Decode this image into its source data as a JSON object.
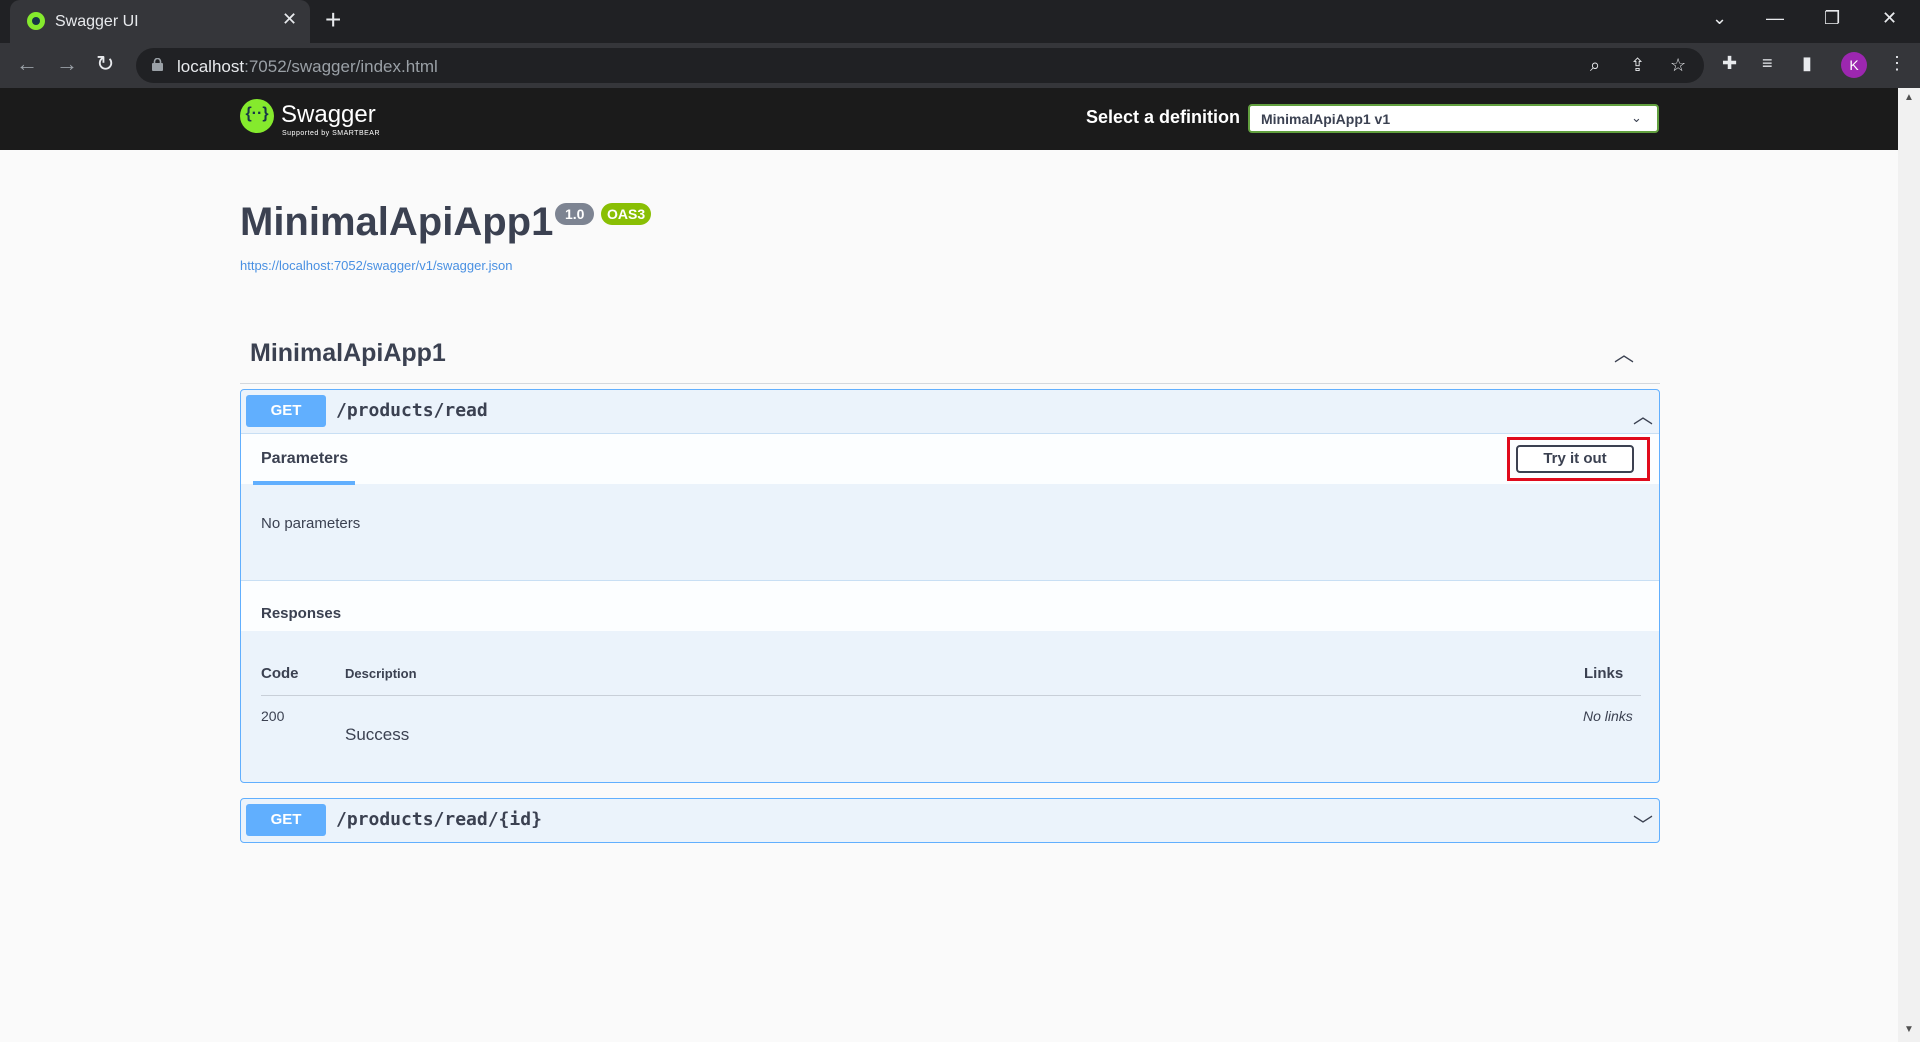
{
  "browser": {
    "tab_title": "Swagger UI",
    "tab_close": "✕",
    "new_tab": "+",
    "url_host": "localhost",
    "url_path": ":7052/swagger/index.html",
    "avatar_letter": "K",
    "window_controls": {
      "chevron": "⌄",
      "minimize": "—",
      "restore": "❐",
      "close": "✕"
    },
    "icons": [
      "zoom-icon",
      "share-icon",
      "star-icon",
      "extensions-icon",
      "media-icon",
      "sidepanel-icon",
      "menu-icon"
    ]
  },
  "swagger_header": {
    "logo_text": "Swagger",
    "logo_sub": "Supported by SMARTBEAR",
    "definition_label": "Select a definition",
    "definition_selected": "MinimalApiApp1 v1"
  },
  "info": {
    "title": "MinimalApiApp1",
    "version": "1.0",
    "oas_badge": "OAS3",
    "spec_url": "https://localhost:7052/swagger/v1/swagger.json"
  },
  "tag": {
    "name": "MinimalApiApp1",
    "operations": [
      {
        "method": "GET",
        "path": "/products/read",
        "expanded": true,
        "parameters_tab": "Parameters",
        "try_it_out": "Try it out",
        "no_parameters": "No parameters",
        "responses_title": "Responses",
        "columns": {
          "code": "Code",
          "description": "Description",
          "links": "Links"
        },
        "responses": [
          {
            "code": "200",
            "description": "Success",
            "links": "No links"
          }
        ]
      },
      {
        "method": "GET",
        "path": "/products/read/{id}",
        "expanded": false
      }
    ]
  },
  "colors": {
    "get_method": "#61affe",
    "opblock_bg": "#ebf3fb",
    "topbar_bg": "#1b1b1b",
    "oas_badge": "#89bf04",
    "version_badge": "#7d8492",
    "highlight_box": "#e00b1c"
  }
}
